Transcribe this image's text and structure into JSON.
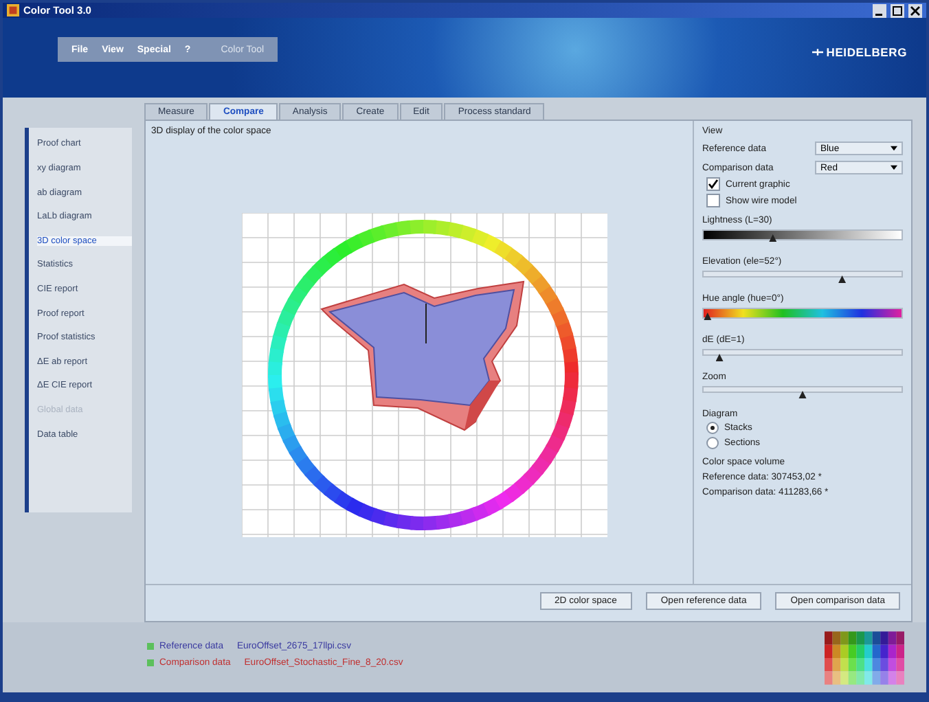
{
  "window": {
    "title": "Color Tool 3.0"
  },
  "menu": [
    {
      "label": "File",
      "disabled": false
    },
    {
      "label": "View",
      "disabled": false
    },
    {
      "label": "Special",
      "disabled": false
    },
    {
      "label": "?",
      "disabled": false
    },
    {
      "label": "Color Tool",
      "disabled": true
    }
  ],
  "logo": "HEIDELBERG",
  "tabs": [
    {
      "label": "Measure",
      "selected": false
    },
    {
      "label": "Compare",
      "selected": true
    },
    {
      "label": "Analysis",
      "selected": false
    },
    {
      "label": "Create",
      "selected": false
    },
    {
      "label": "Edit",
      "selected": false
    },
    {
      "label": "Process standard",
      "selected": false
    }
  ],
  "sidebar": {
    "items": [
      {
        "label": "Proof chart",
        "selected": false,
        "disabled": false
      },
      {
        "label": "xy diagram",
        "selected": false,
        "disabled": false
      },
      {
        "label": "ab diagram",
        "selected": false,
        "disabled": false
      },
      {
        "label": "LaLb diagram",
        "selected": false,
        "disabled": false
      },
      {
        "label": "3D color space",
        "selected": true,
        "disabled": false
      },
      {
        "label": "Statistics",
        "selected": false,
        "disabled": false
      },
      {
        "label": "CIE report",
        "selected": false,
        "disabled": false
      },
      {
        "label": "Proof report",
        "selected": false,
        "disabled": false
      },
      {
        "label": "Proof statistics",
        "selected": false,
        "disabled": false
      },
      {
        "label": "ΔE ab report",
        "selected": false,
        "disabled": false
      },
      {
        "label": "ΔE CIE report",
        "selected": false,
        "disabled": false
      },
      {
        "label": "Global data",
        "selected": false,
        "disabled": true
      },
      {
        "label": "Data table",
        "selected": false,
        "disabled": false
      }
    ]
  },
  "chart_panel": {
    "title": "3D display of the color space"
  },
  "view": {
    "title": "View",
    "dropdowns": [
      {
        "label": "Reference data",
        "value": "Blue"
      },
      {
        "label": "Comparison data",
        "value": "Red"
      }
    ],
    "checkboxes": [
      {
        "label": "Current graphic",
        "checked": true
      },
      {
        "label": "Show wire model",
        "checked": false
      }
    ],
    "sliders": [
      {
        "label": "Lightness (L=30)",
        "kind": "gray",
        "level": 0.35
      },
      {
        "label": "Elevation (ele=52°)",
        "kind": "plain",
        "level": 0.7
      },
      {
        "label": "Hue angle (hue=0°)",
        "kind": "hue",
        "level": 0.02
      },
      {
        "label": "dE (dE=1)",
        "kind": "plain",
        "level": 0.08
      },
      {
        "label": "Zoom",
        "kind": "plain",
        "level": 0.5
      }
    ],
    "diagram": {
      "title": "Diagram",
      "options": [
        {
          "label": "Stacks",
          "selected": true
        },
        {
          "label": "Sections",
          "selected": false
        }
      ]
    },
    "volume": {
      "title": "Color space volume",
      "lines": [
        "Reference data: 307453,02 *",
        "Comparison data: 411283,66 *"
      ]
    }
  },
  "buttons": [
    "2D color space",
    "Open reference data",
    "Open comparison data"
  ],
  "status": [
    {
      "label": "Reference data",
      "file": "EuroOffset_2675_17llpi.csv",
      "color": "#3a3aa0"
    },
    {
      "label": "Comparison data",
      "file": "EuroOffset_Stochastic_Fine_8_20.csv",
      "color": "#c03030"
    }
  ]
}
